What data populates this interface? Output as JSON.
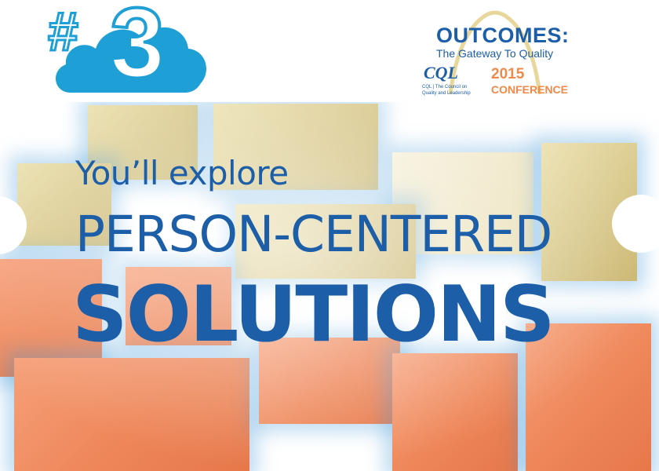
{
  "badge": {
    "hash": "#",
    "number": "3"
  },
  "logo": {
    "title": "OUTCOMES:",
    "tagline": "The Gateway To Quality",
    "mark": "CQL",
    "org_line1": "CQL | The Council on",
    "org_line2": "Quality and Leadership",
    "year": "2015",
    "event": "CONFERENCE"
  },
  "headline": {
    "line1": "You’ll explore",
    "line2": "PERSON-CENTERED",
    "line3": "SOLUTIONS"
  },
  "colors": {
    "primary_blue": "#1c5ea8",
    "cloud_blue": "#1e9fd6",
    "accent_orange": "#f08a4b",
    "photo_gold": "#d9c98c",
    "photo_orange": "#ee8658"
  }
}
